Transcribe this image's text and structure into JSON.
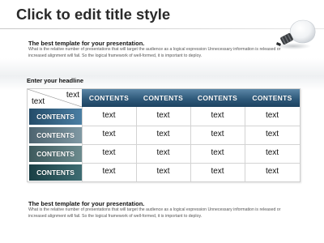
{
  "slide": {
    "title": "Click to edit title style",
    "intro": {
      "heading": "The best template for your presentation.",
      "body": "What is the relative number of presentations that will target the audience as a logical expression Unnecessary information is released or increased alignment will fail. So the logical framework of well-formed, it is important to deploy."
    },
    "headline": "Enter your headline",
    "outro": {
      "heading": "The best template for your presentation.",
      "body": "What is the relative number of presentations that will target the audience as a logical expression Unnecessary information is released or increased alignment will fail. So the logical framework of well-formed, it is important to deploy."
    }
  },
  "table": {
    "corner_top_right": "text",
    "corner_bottom_left": "text",
    "column_headers": [
      "CONTENTS",
      "CONTENTS",
      "CONTENTS",
      "CONTENTS"
    ],
    "row_headers": [
      "CONTENTS",
      "CONTENTS",
      "CONTENTS",
      "CONTENTS"
    ],
    "rows": [
      [
        "text",
        "text",
        "text",
        "text"
      ],
      [
        "text",
        "text",
        "text",
        "text"
      ],
      [
        "text",
        "text",
        "text",
        "text"
      ],
      [
        "text",
        "text",
        "text",
        "text"
      ]
    ]
  },
  "colors": {
    "header_blue": "#2f5a7b",
    "row_header_shades": [
      "#2e5f80",
      "#5b7480",
      "#49686b",
      "#234f55"
    ]
  },
  "icons": {
    "decoration": "light-bulb-icon"
  }
}
